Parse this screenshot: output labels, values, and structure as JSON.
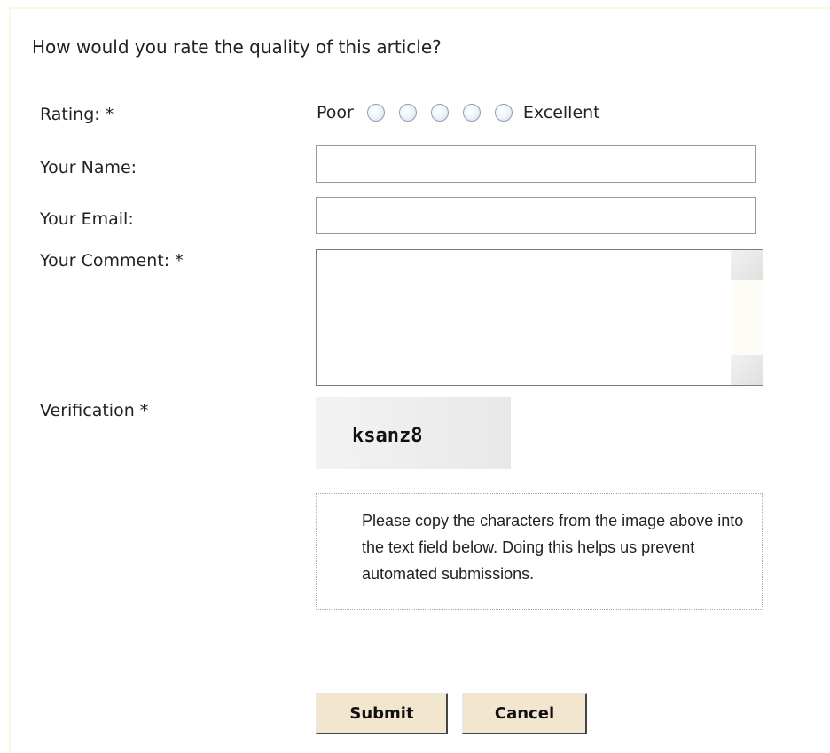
{
  "form": {
    "question": "How would you rate the quality of this article?",
    "rating": {
      "label": "Rating: *",
      "low_label": "Poor",
      "high_label": "Excellent",
      "options": [
        1,
        2,
        3,
        4,
        5
      ],
      "selected": null
    },
    "name": {
      "label": "Your Name:",
      "value": ""
    },
    "email": {
      "label": "Your Email:",
      "value": ""
    },
    "comment": {
      "label": "Your Comment: *",
      "value": ""
    },
    "verification": {
      "label": "Verification *",
      "captcha_text": "ksanz8",
      "hint": "Please copy the characters from the image above into the text field below. Doing this helps us prevent automated submissions.",
      "value": ""
    },
    "buttons": {
      "submit": "Submit",
      "cancel": "Cancel"
    }
  }
}
